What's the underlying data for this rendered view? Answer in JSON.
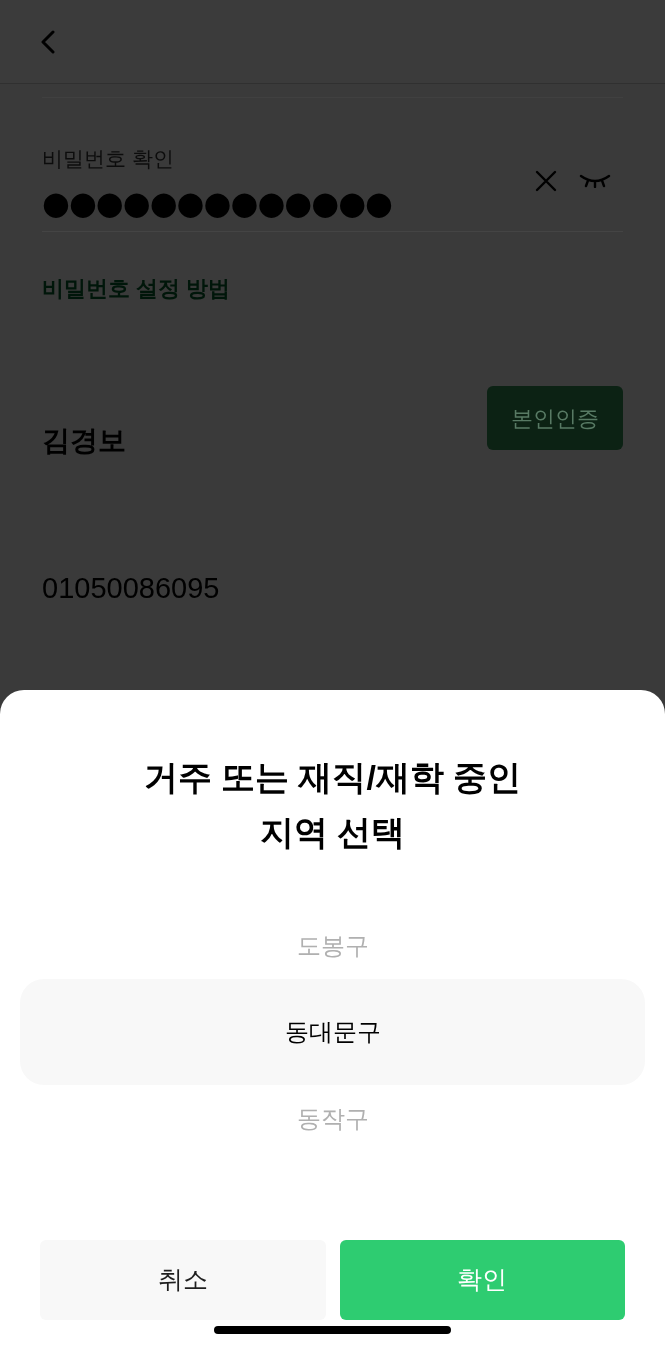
{
  "password_confirm": {
    "label": "비밀번호 확인",
    "value": "●●●●●●●●●●●●●"
  },
  "password_help_link": "비밀번호 설정 방법",
  "name": {
    "value": "김경보",
    "verify_button": "본인인증"
  },
  "phone": {
    "value": "01050086095"
  },
  "region_sheet": {
    "title": "거주 또는 재직/재학 중인\n지역 선택",
    "options": [
      {
        "label": "도봉구",
        "selected": false
      },
      {
        "label": "동대문구",
        "selected": true
      },
      {
        "label": "동작구",
        "selected": false
      }
    ],
    "buttons": [
      {
        "label": "취소",
        "kind": "secondary"
      },
      {
        "label": "확인",
        "kind": "primary"
      }
    ]
  }
}
